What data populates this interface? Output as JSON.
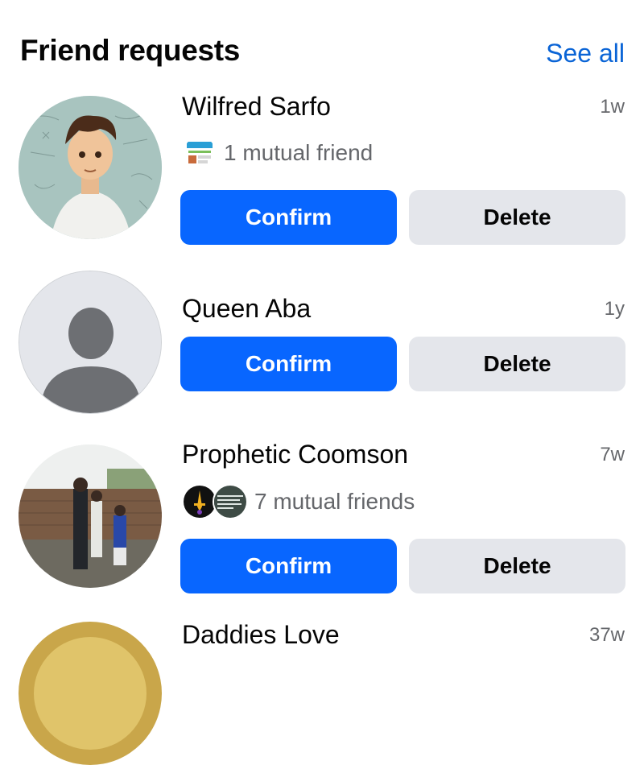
{
  "header": {
    "title": "Friend requests",
    "see_all": "See all"
  },
  "requests": [
    {
      "name": "Wilfred Sarfo",
      "time": "1w",
      "mutual": "1 mutual friend",
      "confirm": "Confirm",
      "delete": "Delete",
      "avatar": "cartoon-boy-photo",
      "mutual_avatars": [
        "logo-thumbnail"
      ]
    },
    {
      "name": "Queen Aba",
      "time": "1y",
      "confirm": "Confirm",
      "delete": "Delete",
      "avatar": "default-person-silhouette"
    },
    {
      "name": "Prophetic Coomson",
      "time": "7w",
      "mutual": "7 mutual friends",
      "confirm": "Confirm",
      "delete": "Delete",
      "avatar": "group-outdoor-photo",
      "mutual_avatars": [
        "sword-thumbnail",
        "text-thumbnail"
      ]
    },
    {
      "name": "Daddies Love",
      "time": "37w",
      "avatar": "gold-circle-photo"
    }
  ],
  "colors": {
    "confirm_bg": "#0866ff",
    "delete_bg": "#e4e6eb",
    "link": "#0a64d6",
    "secondary_text": "#65676b"
  }
}
